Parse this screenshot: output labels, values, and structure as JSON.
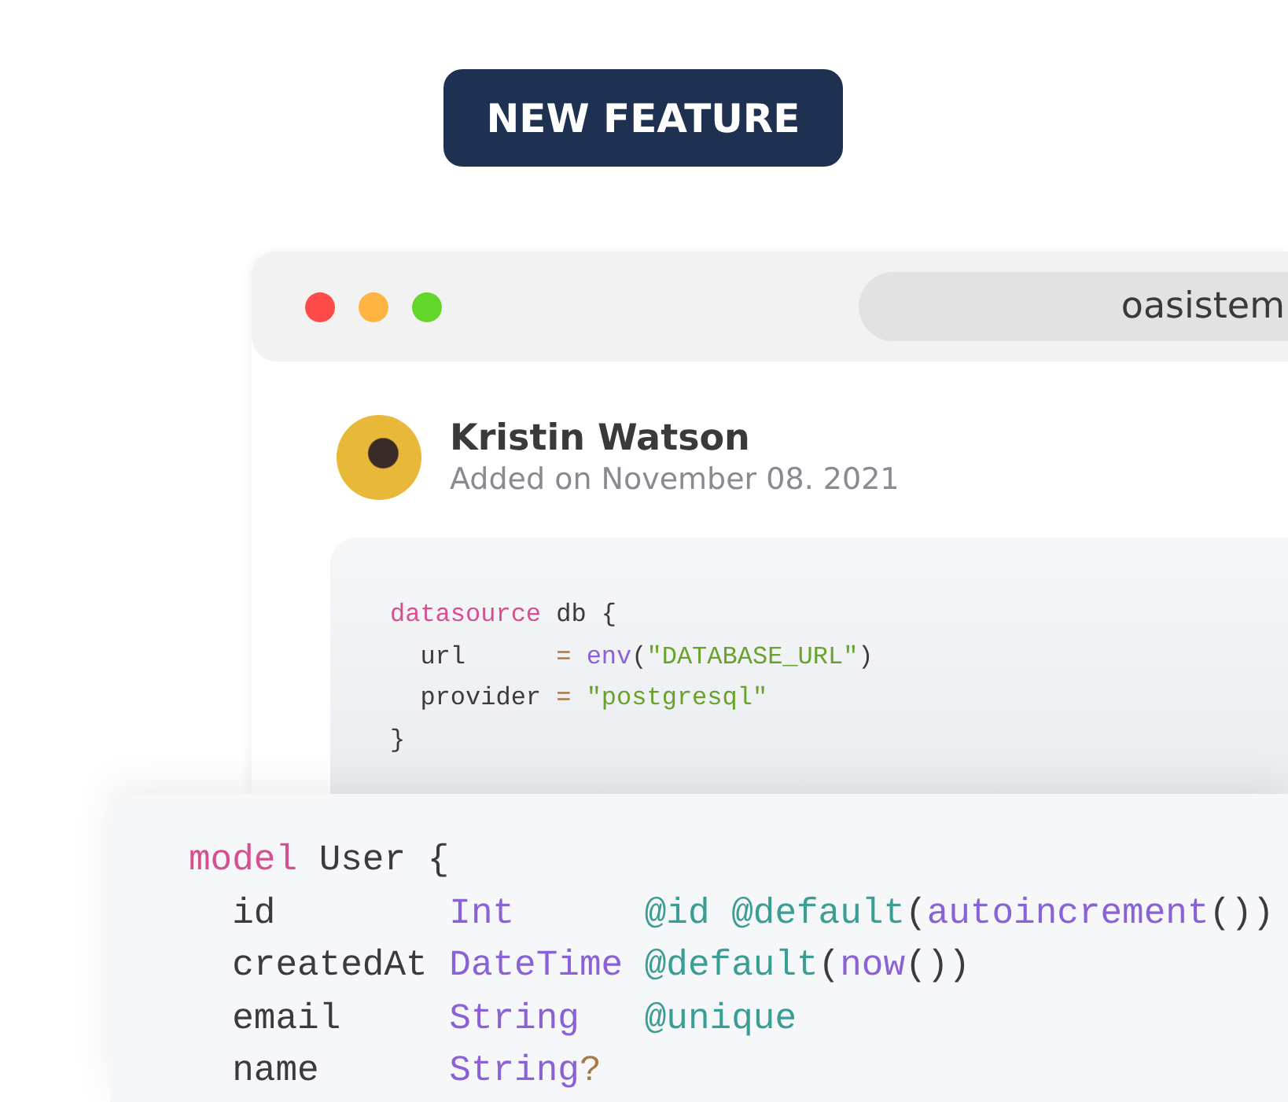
{
  "badge": "NEW FEATURE",
  "browser": {
    "address": "oasistem",
    "post": {
      "author": "Kristin Watson",
      "date": "Added on November 08. 2021"
    },
    "code": [
      [
        {
          "kind": "keyword",
          "text": "datasource"
        },
        {
          "kind": "plain",
          "text": " db {"
        }
      ],
      [
        {
          "kind": "plain",
          "text": "  url      "
        },
        {
          "kind": "op",
          "text": "= "
        },
        {
          "kind": "func",
          "text": "env"
        },
        {
          "kind": "plain",
          "text": "("
        },
        {
          "kind": "string",
          "text": "\"DATABASE_URL\""
        },
        {
          "kind": "plain",
          "text": ")"
        }
      ],
      [
        {
          "kind": "plain",
          "text": "  provider "
        },
        {
          "kind": "op",
          "text": "= "
        },
        {
          "kind": "string",
          "text": "\"postgresql\""
        }
      ],
      [
        {
          "kind": "plain",
          "text": "}"
        }
      ]
    ]
  },
  "schema": [
    [
      {
        "kind": "keyword",
        "text": "model"
      },
      {
        "kind": "plain",
        "text": " User {"
      }
    ],
    [
      {
        "kind": "plain",
        "text": "  id        "
      },
      {
        "kind": "type",
        "text": "Int      "
      },
      {
        "kind": "attr",
        "text": "@id @default"
      },
      {
        "kind": "plain",
        "text": "("
      },
      {
        "kind": "func",
        "text": "autoincrement"
      },
      {
        "kind": "plain",
        "text": "())"
      }
    ],
    [
      {
        "kind": "plain",
        "text": "  createdAt "
      },
      {
        "kind": "type",
        "text": "DateTime "
      },
      {
        "kind": "attr",
        "text": "@default"
      },
      {
        "kind": "plain",
        "text": "("
      },
      {
        "kind": "func",
        "text": "now"
      },
      {
        "kind": "plain",
        "text": "())"
      }
    ],
    [
      {
        "kind": "plain",
        "text": "  email     "
      },
      {
        "kind": "type",
        "text": "String   "
      },
      {
        "kind": "attr",
        "text": "@unique"
      }
    ],
    [
      {
        "kind": "plain",
        "text": "  name      "
      },
      {
        "kind": "type",
        "text": "String"
      },
      {
        "kind": "op",
        "text": "?"
      }
    ]
  ]
}
